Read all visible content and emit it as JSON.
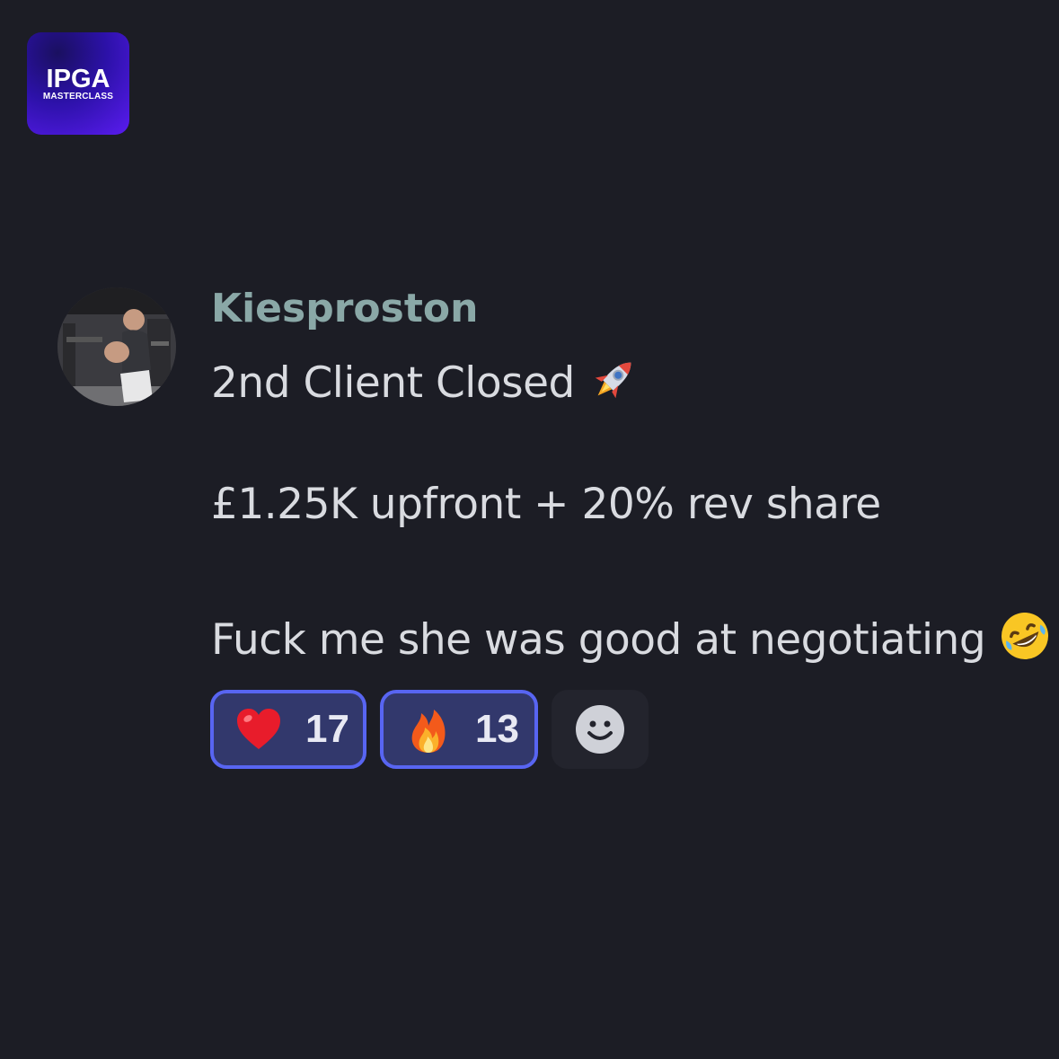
{
  "brand": {
    "logo_text": "IPGA",
    "logo_subtext": "MASTERCLASS"
  },
  "message": {
    "author": "Kiesproston",
    "avatar_icon": "user-avatar",
    "lines": [
      "2nd Client Closed",
      "£1.25K upfront + 20% rev share",
      "Fuck me she was good at negotiating"
    ],
    "line_emojis": [
      "rocket-icon",
      "",
      "rolling-on-floor-laughing-icon"
    ]
  },
  "reactions": [
    {
      "icon": "heart-icon",
      "count": "17"
    },
    {
      "icon": "fire-icon",
      "count": "13"
    }
  ],
  "add_reaction_icon": "smiley-add-reaction-icon",
  "colors": {
    "background": "#1c1d25",
    "username": "#8aa8a7",
    "text": "#d9dbe0",
    "reaction_border": "#5865f2",
    "reaction_fill": "#32386c"
  }
}
